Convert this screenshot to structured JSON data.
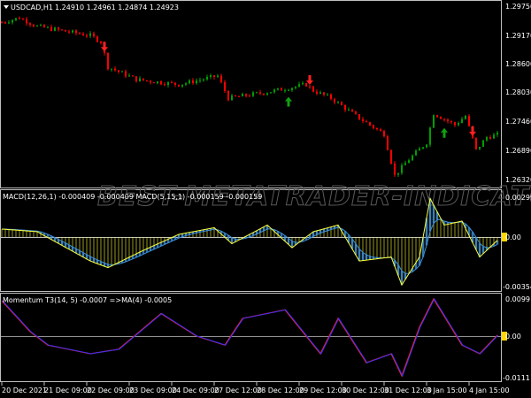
{
  "main": {
    "title": "USDCAD,H1",
    "ohlc": "1.24910 1.24961 1.24874 1.24923",
    "price_ticks": [
      "1.29750",
      "1.29170",
      "1.28600",
      "1.28030",
      "1.27460",
      "1.26890",
      "1.26320"
    ]
  },
  "macd": {
    "legend": "MACD(12,26,1) -0.000409 -0.000409  MACD(5,15,1) -0.000159 -0.000159",
    "ticks": [
      "0.00299",
      "0.00",
      "-0.003543"
    ],
    "current": "0.00"
  },
  "momentum": {
    "legend": "Momentum T3(14, 5) -0.0007  =>MA(4) -0.0005",
    "ticks": [
      "0.0099",
      "0.00",
      "-0.0111"
    ],
    "current": "0.00"
  },
  "time_axis": [
    "20 Dec 2021",
    "21 Dec 09:00",
    "22 Dec 09:00",
    "23 Dec 09:00",
    "24 Dec 09:00",
    "27 Dec 12:00",
    "28 Dec 12:00",
    "29 Dec 12:00",
    "30 Dec 12:00",
    "31 Dec 12:00",
    "3 Jan 15:00",
    "4 Jan 15:00"
  ],
  "watermark": "BEST-METATRADER-INDICATORS.COM",
  "colors": {
    "bull": "#00a000",
    "bear": "#ff0000",
    "macd": "#ffff33",
    "signal": "#3c8fd8",
    "mom": "#ff2020",
    "mom_ma": "#3030ff",
    "axis": "#c0c0c0"
  },
  "chart_data": {
    "type": "candlestick",
    "symbol": "USDCAD",
    "timeframe": "H1",
    "ylim": [
      1.2632,
      1.2975
    ],
    "bars": 141,
    "close_keypoints": [
      [
        0,
        1.2943
      ],
      [
        5,
        1.2952
      ],
      [
        10,
        1.2935
      ],
      [
        25,
        1.2917
      ],
      [
        28,
        1.2905
      ],
      [
        30,
        1.2855
      ],
      [
        38,
        1.283
      ],
      [
        50,
        1.282
      ],
      [
        61,
        1.2837
      ],
      [
        64,
        1.2793
      ],
      [
        75,
        1.2805
      ],
      [
        86,
        1.282
      ],
      [
        88,
        1.2808
      ],
      [
        93,
        1.2793
      ],
      [
        100,
        1.2758
      ],
      [
        108,
        1.2722
      ],
      [
        111,
        1.264
      ],
      [
        115,
        1.2672
      ],
      [
        120,
        1.2705
      ],
      [
        122,
        1.2763
      ],
      [
        128,
        1.274
      ],
      [
        131,
        1.2758
      ],
      [
        134,
        1.269
      ],
      [
        137,
        1.2716
      ],
      [
        141,
        1.2722
      ]
    ],
    "signals": [
      {
        "type": "sell",
        "bar": 29
      },
      {
        "type": "buy",
        "bar": 81
      },
      {
        "type": "sell",
        "bar": 87
      },
      {
        "type": "buy",
        "bar": 125
      },
      {
        "type": "sell",
        "bar": 133
      }
    ],
    "macd_ylim": [
      -0.003543,
      0.00299
    ],
    "macd_keypoints": [
      [
        0,
        0.0006
      ],
      [
        10,
        0.0004
      ],
      [
        25,
        -0.0018
      ],
      [
        30,
        -0.0023
      ],
      [
        40,
        -0.001
      ],
      [
        50,
        0.0002
      ],
      [
        60,
        0.0007
      ],
      [
        65,
        -0.0005
      ],
      [
        75,
        0.0009
      ],
      [
        82,
        -0.0008
      ],
      [
        88,
        0.0004
      ],
      [
        95,
        0.0009
      ],
      [
        101,
        -0.0018
      ],
      [
        110,
        -0.0015
      ],
      [
        113,
        -0.0036
      ],
      [
        118,
        -0.0015
      ],
      [
        121,
        0.0029
      ],
      [
        125,
        0.0009
      ],
      [
        130,
        0.0012
      ],
      [
        135,
        -0.0015
      ],
      [
        141,
        0.0
      ]
    ],
    "momentum_ylim": [
      -0.0111,
      0.0099
    ],
    "momentum_keypoints": [
      [
        0,
        0.0094
      ],
      [
        8,
        0.0012
      ],
      [
        13,
        -0.0024
      ],
      [
        25,
        -0.0047
      ],
      [
        33,
        -0.0035
      ],
      [
        45,
        0.006
      ],
      [
        55,
        0.0
      ],
      [
        63,
        -0.0024
      ],
      [
        68,
        0.0047
      ],
      [
        80,
        0.007
      ],
      [
        90,
        -0.0047
      ],
      [
        95,
        0.0047
      ],
      [
        103,
        -0.0071
      ],
      [
        110,
        -0.0047
      ],
      [
        113,
        -0.0106
      ],
      [
        118,
        0.0024
      ],
      [
        122,
        0.0099
      ],
      [
        130,
        -0.0024
      ],
      [
        135,
        -0.0047
      ],
      [
        141,
        0.0012
      ]
    ]
  }
}
